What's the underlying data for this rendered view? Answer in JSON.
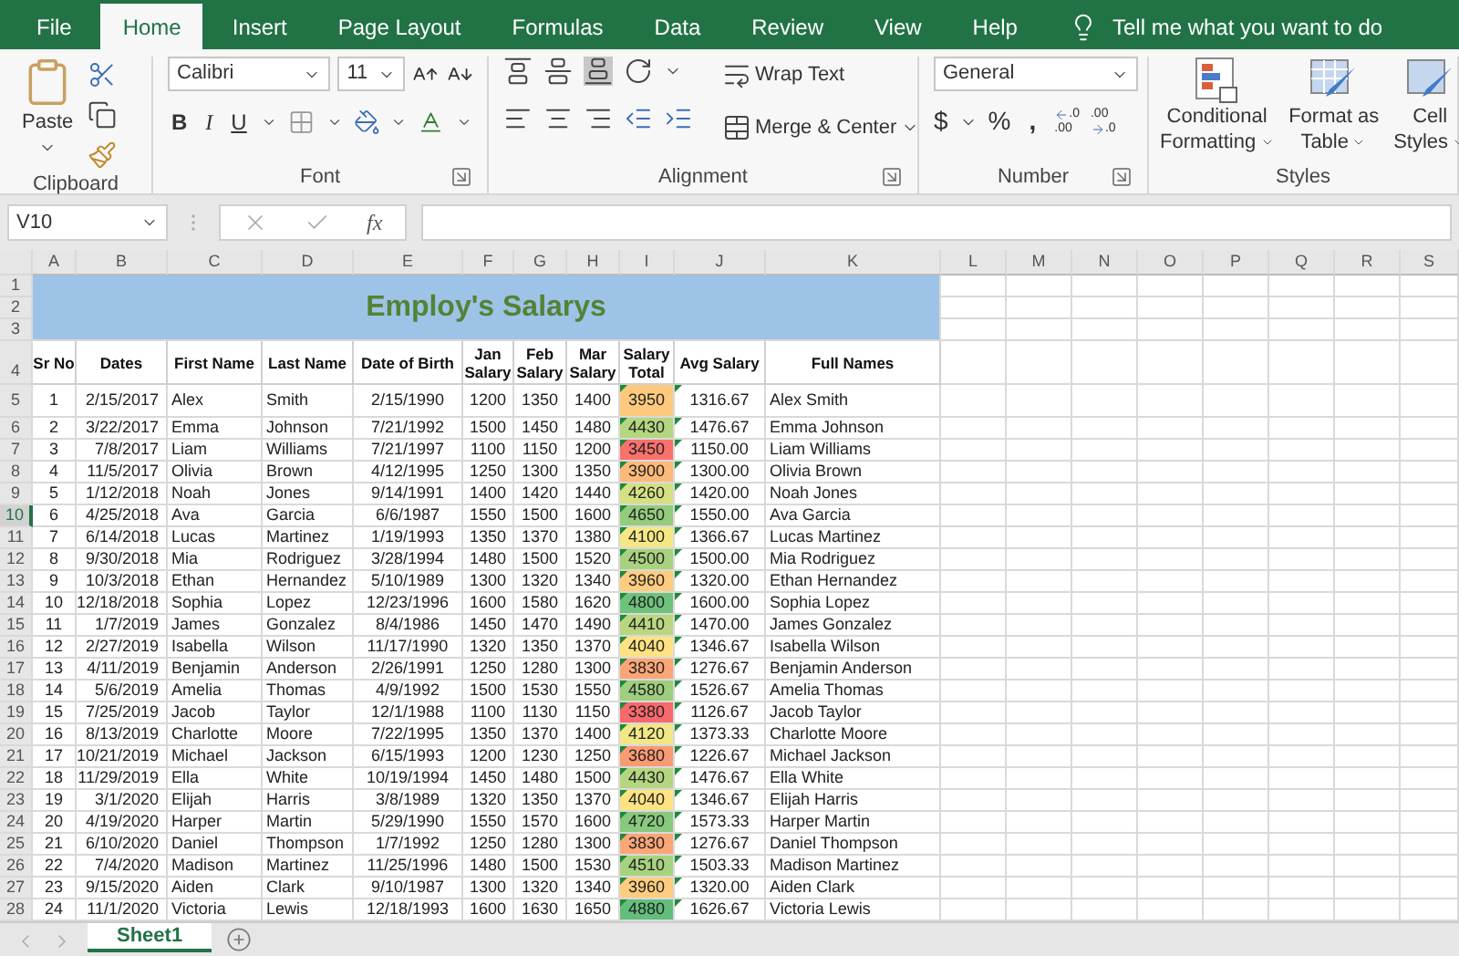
{
  "menu_tabs": [
    {
      "label": "File",
      "selected": false
    },
    {
      "label": "Home",
      "selected": true
    },
    {
      "label": "Insert",
      "selected": false
    },
    {
      "label": "Page Layout",
      "selected": false
    },
    {
      "label": "Formulas",
      "selected": false
    },
    {
      "label": "Data",
      "selected": false
    },
    {
      "label": "Review",
      "selected": false
    },
    {
      "label": "View",
      "selected": false
    },
    {
      "label": "Help",
      "selected": false
    }
  ],
  "tell_me": "Tell me what you want to do",
  "ribbon": {
    "clipboard": {
      "paste": "Paste",
      "label": "Clipboard"
    },
    "font": {
      "name": "Calibri",
      "size": "11",
      "bold": "B",
      "italic": "I",
      "underline": "U",
      "label": "Font"
    },
    "alignment": {
      "wrap": "Wrap Text",
      "merge": "Merge & Center",
      "label": "Alignment"
    },
    "number": {
      "format": "General",
      "currency": "$",
      "percent": "%",
      "comma": ",",
      "decimals": [
        {
          "top": ".0",
          "bottom": ".00"
        },
        {
          "top": ".00",
          "bottom": ".0"
        }
      ],
      "label": "Number"
    },
    "styles": {
      "buttons": [
        {
          "kind": "conditional",
          "lines": [
            "Conditional",
            "Formatting"
          ]
        },
        {
          "kind": "table",
          "lines": [
            "Format as",
            "Table"
          ]
        },
        {
          "kind": "cell",
          "lines": [
            "Cell",
            "Styles"
          ]
        }
      ],
      "label": "Styles"
    }
  },
  "name_box": "V10",
  "fx": "fx",
  "columns": [
    "A",
    "B",
    "C",
    "D",
    "E",
    "F",
    "G",
    "H",
    "I",
    "J",
    "K",
    "L",
    "M",
    "N",
    "O",
    "P",
    "Q",
    "R",
    "S"
  ],
  "sheet": {
    "title": "Employ's Salarys",
    "title_rows": [
      "1",
      "2",
      "3"
    ],
    "header_row": "4",
    "headers": [
      "Sr No",
      "Dates",
      "First Name",
      "Last Name",
      "Date of Birth",
      "Jan Salary",
      "Feb Salary",
      "Mar Salary",
      "Salary Total",
      "Avg Salary",
      "Full Names"
    ],
    "rows": [
      {
        "row": "5",
        "selected": false,
        "color": "#fdc97d",
        "cells": [
          "1",
          "2/15/2017",
          "Alex",
          "Smith",
          "2/15/1990",
          "1200",
          "1350",
          "1400",
          "3950",
          "1316.67",
          "Alex Smith"
        ]
      },
      {
        "row": "6",
        "selected": false,
        "color": "#b5d680",
        "cells": [
          "2",
          "3/22/2017",
          "Emma",
          "Johnson",
          "7/21/1992",
          "1500",
          "1450",
          "1480",
          "4430",
          "1476.67",
          "Emma Johnson"
        ]
      },
      {
        "row": "7",
        "selected": false,
        "color": "#f8716b",
        "cells": [
          "3",
          "7/8/2017",
          "Liam",
          "Williams",
          "7/21/1997",
          "1100",
          "1150",
          "1200",
          "3450",
          "1150.00",
          "Liam Williams"
        ]
      },
      {
        "row": "8",
        "selected": false,
        "color": "#fcb97a",
        "cells": [
          "4",
          "11/5/2017",
          "Olivia",
          "Brown",
          "4/12/1995",
          "1250",
          "1300",
          "1350",
          "3900",
          "1300.00",
          "Olivia Brown"
        ]
      },
      {
        "row": "9",
        "selected": false,
        "color": "#d5e082",
        "cells": [
          "5",
          "1/12/2018",
          "Noah",
          "Jones",
          "9/14/1991",
          "1400",
          "1420",
          "1440",
          "4260",
          "1420.00",
          "Noah Jones"
        ]
      },
      {
        "row": "10",
        "selected": true,
        "color": "#94cc7e",
        "cells": [
          "6",
          "4/25/2018",
          "Ava",
          "Garcia",
          "6/6/1987",
          "1550",
          "1500",
          "1600",
          "4650",
          "1550.00",
          "Ava Garcia"
        ]
      },
      {
        "row": "11",
        "selected": false,
        "color": "#f5e884",
        "cells": [
          "7",
          "6/14/2018",
          "Lucas",
          "Martinez",
          "1/19/1993",
          "1350",
          "1370",
          "1380",
          "4100",
          "1366.67",
          "Lucas Martinez"
        ]
      },
      {
        "row": "12",
        "selected": false,
        "color": "#a9d27f",
        "cells": [
          "8",
          "9/30/2018",
          "Mia",
          "Rodriguez",
          "3/28/1994",
          "1480",
          "1500",
          "1520",
          "4500",
          "1500.00",
          "Mia Rodriguez"
        ]
      },
      {
        "row": "13",
        "selected": false,
        "color": "#fdcc7e",
        "cells": [
          "9",
          "10/3/2018",
          "Ethan",
          "Hernandez",
          "5/10/1989",
          "1300",
          "1320",
          "1340",
          "3960",
          "1320.00",
          "Ethan Hernandez"
        ]
      },
      {
        "row": "14",
        "selected": false,
        "color": "#6fc27c",
        "cells": [
          "10",
          "12/18/2018",
          "Sophia",
          "Lopez",
          "12/23/1996",
          "1600",
          "1580",
          "1620",
          "4800",
          "1600.00",
          "Sophia Lopez"
        ]
      },
      {
        "row": "15",
        "selected": false,
        "color": "#b9d780",
        "cells": [
          "11",
          "1/7/2019",
          "James",
          "Gonzalez",
          "8/4/1986",
          "1450",
          "1470",
          "1490",
          "4410",
          "1470.00",
          "James Gonzalez"
        ]
      },
      {
        "row": "16",
        "selected": false,
        "color": "#ffe383",
        "cells": [
          "12",
          "2/27/2019",
          "Isabella",
          "Wilson",
          "11/17/1990",
          "1320",
          "1350",
          "1370",
          "4040",
          "1346.67",
          "Isabella Wilson"
        ]
      },
      {
        "row": "17",
        "selected": false,
        "color": "#fba677",
        "cells": [
          "13",
          "4/11/2019",
          "Benjamin",
          "Anderson",
          "2/26/1991",
          "1250",
          "1280",
          "1300",
          "3830",
          "1276.67",
          "Benjamin Anderson"
        ]
      },
      {
        "row": "18",
        "selected": false,
        "color": "#9ece7e",
        "cells": [
          "14",
          "5/6/2019",
          "Amelia",
          "Thomas",
          "4/9/1992",
          "1500",
          "1530",
          "1550",
          "4580",
          "1526.67",
          "Amelia Thomas"
        ]
      },
      {
        "row": "19",
        "selected": false,
        "color": "#f8696b",
        "cells": [
          "15",
          "7/25/2019",
          "Jacob",
          "Taylor",
          "12/1/1988",
          "1100",
          "1130",
          "1150",
          "3380",
          "1126.67",
          "Jacob Taylor"
        ]
      },
      {
        "row": "20",
        "selected": false,
        "color": "#f2e784",
        "cells": [
          "16",
          "8/13/2019",
          "Charlotte",
          "Moore",
          "7/22/1995",
          "1350",
          "1370",
          "1400",
          "4120",
          "1373.33",
          "Charlotte Moore"
        ]
      },
      {
        "row": "21",
        "selected": false,
        "color": "#fa9a73",
        "cells": [
          "17",
          "10/21/2019",
          "Michael",
          "Jackson",
          "6/15/1993",
          "1200",
          "1230",
          "1250",
          "3680",
          "1226.67",
          "Michael Jackson"
        ]
      },
      {
        "row": "22",
        "selected": false,
        "color": "#b5d680",
        "cells": [
          "18",
          "11/29/2019",
          "Ella",
          "White",
          "10/19/1994",
          "1450",
          "1480",
          "1500",
          "4430",
          "1476.67",
          "Ella White"
        ]
      },
      {
        "row": "23",
        "selected": false,
        "color": "#ffe383",
        "cells": [
          "19",
          "3/1/2020",
          "Elijah",
          "Harris",
          "3/8/1989",
          "1320",
          "1350",
          "1370",
          "4040",
          "1346.67",
          "Elijah Harris"
        ]
      },
      {
        "row": "24",
        "selected": false,
        "color": "#88c97d",
        "cells": [
          "20",
          "4/19/2020",
          "Harper",
          "Martin",
          "5/29/1990",
          "1550",
          "1570",
          "1600",
          "4720",
          "1573.33",
          "Harper Martin"
        ]
      },
      {
        "row": "25",
        "selected": false,
        "color": "#fba677",
        "cells": [
          "21",
          "6/10/2020",
          "Daniel",
          "Thompson",
          "1/7/1992",
          "1250",
          "1280",
          "1300",
          "3830",
          "1276.67",
          "Daniel Thompson"
        ]
      },
      {
        "row": "26",
        "selected": false,
        "color": "#a7d27f",
        "cells": [
          "22",
          "7/4/2020",
          "Madison",
          "Martinez",
          "11/25/1996",
          "1480",
          "1500",
          "1530",
          "4510",
          "1503.33",
          "Madison Martinez"
        ]
      },
      {
        "row": "27",
        "selected": false,
        "color": "#fdcc7e",
        "cells": [
          "23",
          "9/15/2020",
          "Aiden",
          "Clark",
          "9/10/1987",
          "1300",
          "1320",
          "1340",
          "3960",
          "1320.00",
          "Aiden Clark"
        ]
      },
      {
        "row": "28",
        "selected": false,
        "color": "#63be7b",
        "cells": [
          "24",
          "11/1/2020",
          "Victoria",
          "Lewis",
          "12/18/1993",
          "1600",
          "1630",
          "1650",
          "4880",
          "1626.67",
          "Victoria Lewis"
        ]
      }
    ]
  },
  "sheet_tabs": [
    {
      "label": "Sheet1",
      "selected": true
    }
  ]
}
